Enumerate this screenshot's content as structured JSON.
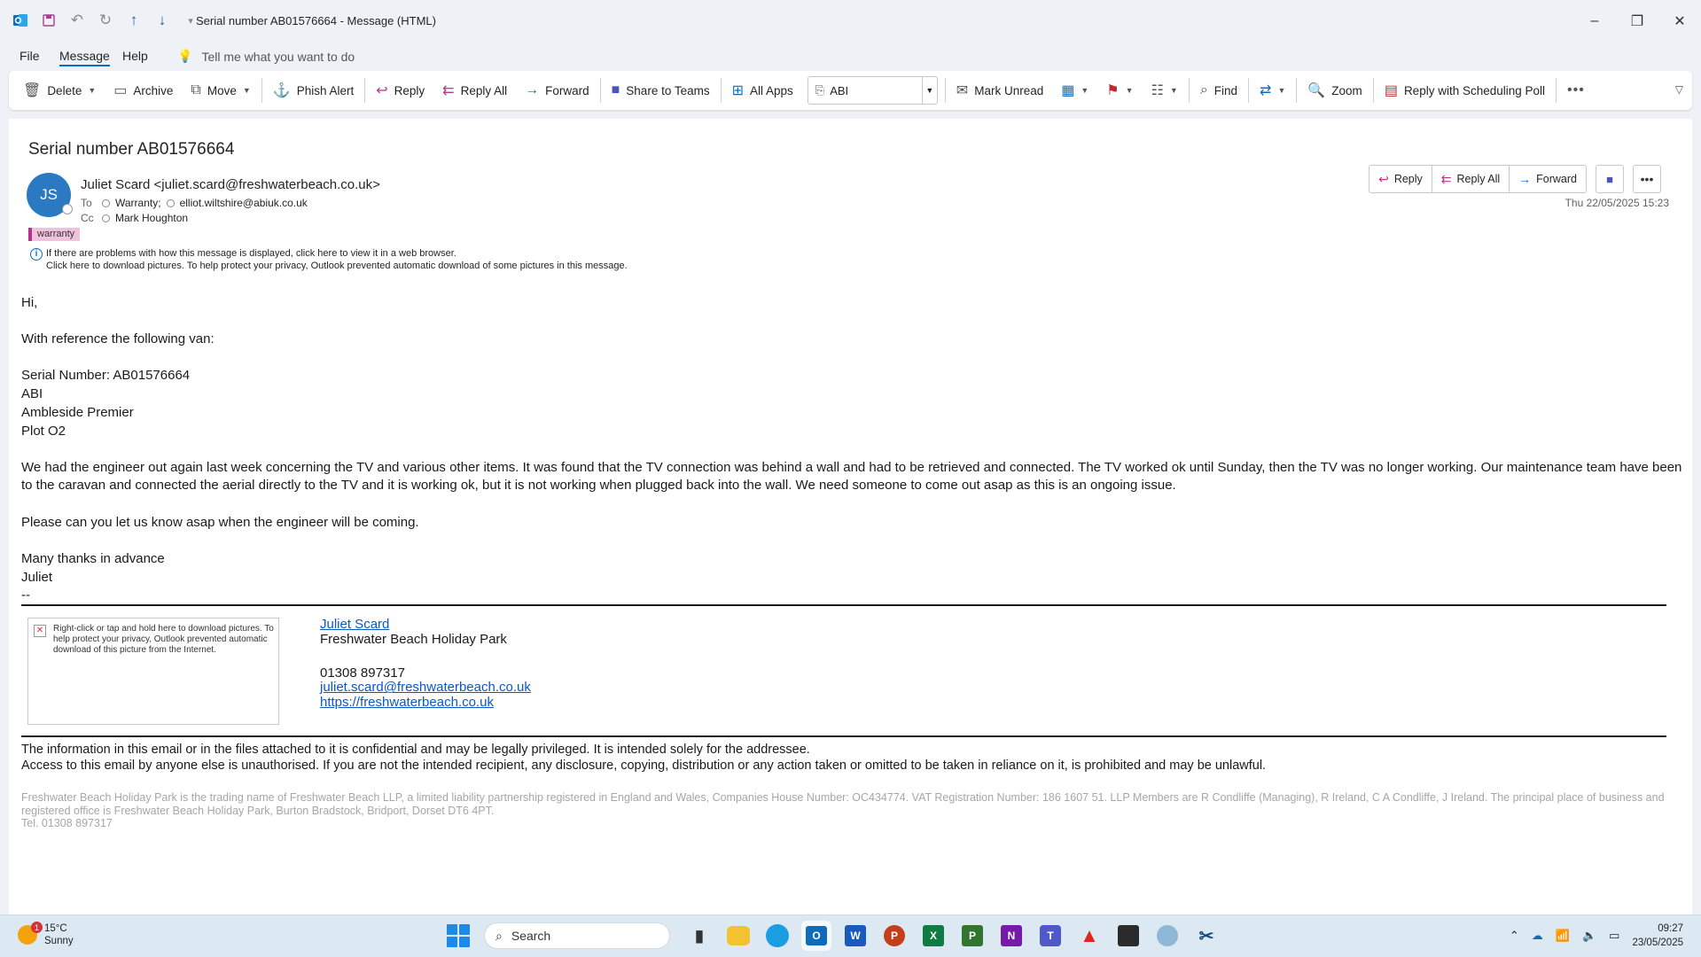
{
  "window": {
    "title": "Serial number AB01576664  -  Message (HTML)"
  },
  "menu": {
    "items": [
      "File",
      "Message",
      "Help"
    ],
    "tellme": "Tell me what you want to do"
  },
  "ribbon": {
    "delete": "Delete",
    "archive": "Archive",
    "move": "Move",
    "phish": "Phish Alert",
    "reply": "Reply",
    "reply_all": "Reply All",
    "forward": "Forward",
    "share_teams": "Share to Teams",
    "all_apps": "All Apps",
    "quick_step": "ABI",
    "mark_unread": "Mark Unread",
    "find": "Find",
    "zoom": "Zoom",
    "scheduling_poll": "Reply with Scheduling Poll"
  },
  "message": {
    "subject": "Serial number AB01576664",
    "avatar_initials": "JS",
    "from": "Juliet Scard <juliet.scard@freshwaterbeach.co.uk>",
    "to_label": "To",
    "to": [
      "Warranty;",
      "elliot.wiltshire@abiuk.co.uk"
    ],
    "cc_label": "Cc",
    "cc": "Mark Houghton",
    "category": "warranty",
    "info_line1": "If there are problems with how this message is displayed, click here to view it in a web browser.",
    "info_line2": "Click here to download pictures. To help protect your privacy, Outlook prevented automatic download of some pictures in this message.",
    "date": "Thu 22/05/2025 15:23",
    "actions": {
      "reply": "Reply",
      "reply_all": "Reply All",
      "forward": "Forward"
    }
  },
  "body": {
    "greeting": "Hi,",
    "ref": "With reference the following van:",
    "serial": "Serial Number: AB01576664",
    "make": "ABI",
    "model": "Ambleside Premier",
    "plot": "Plot O2",
    "para1": "We had the engineer out again last week concerning the TV and various other items. It was found that the TV connection was behind a wall and had to be retrieved and connected. The TV worked ok until Sunday, then the TV was no longer working. Our maintenance team have been to the caravan and connected the aerial directly to the TV and it is working ok, but it is not working when plugged back into the wall. We need someone to come out asap as this is an ongoing issue.",
    "para2": "Please can you let us know asap when the engineer will be coming.",
    "closing": "Many thanks in advance",
    "name": "Juliet",
    "dashes": "--"
  },
  "signature": {
    "image_text": "Right-click or tap and hold here to download pictures. To help protect your privacy, Outlook prevented automatic download of this picture from the Internet.",
    "name": "Juliet Scard",
    "company": "Freshwater Beach Holiday Park",
    "phone": "01308 897317",
    "email": "juliet.scard@freshwaterbeach.co.uk",
    "website": "https://freshwaterbeach.co.uk"
  },
  "disclaimer": {
    "line1": "The information in this email or in the files attached to it is confidential and may be legally privileged. It is intended solely for the addressee.",
    "line2": "Access to this email by anyone else is unauthorised. If you are not the intended recipient, any disclosure, copying, distribution or any action taken or omitted to be taken in reliance on it, is prohibited and may be unlawful.",
    "legal1": "Freshwater Beach Holiday Park is the trading name of Freshwater Beach LLP, a limited liability partnership registered in England and Wales, Companies House Number: OC434774. VAT Registration Number: 186 1607 51. LLP Members are R Condliffe (Managing), R Ireland, C A Condliffe, J Ireland. The principal place of business and registered office is Freshwater Beach Holiday Park, Burton Bradstock, Bridport, Dorset DT6 4PT.",
    "legal2": "Tel. 01308 897317"
  },
  "taskbar": {
    "temp": "15°C",
    "weather": "Sunny",
    "weather_badge": "1",
    "search": "Search",
    "time": "09:27",
    "date": "23/05/2025"
  }
}
